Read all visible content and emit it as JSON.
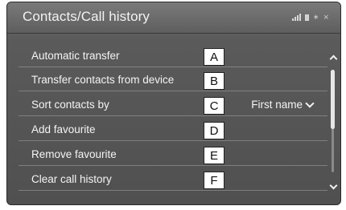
{
  "header": {
    "title": "Contacts/Call history"
  },
  "status_icons": [
    "signal-icon",
    "battery-icon",
    "bluetooth-icon",
    "network-off-icon"
  ],
  "menu": [
    {
      "label": "Automatic transfer",
      "callout": "A"
    },
    {
      "label": "Transfer contacts from device",
      "callout": "B"
    },
    {
      "label": "Sort contacts by",
      "callout": "C",
      "value": "First name"
    },
    {
      "label": "Add favourite",
      "callout": "D"
    },
    {
      "label": "Remove favourite",
      "callout": "E"
    },
    {
      "label": "Clear call history",
      "callout": "F"
    }
  ],
  "colors": {
    "background": "#555555",
    "text": "#f4f4f4",
    "callout_bg": "#ffffff"
  }
}
